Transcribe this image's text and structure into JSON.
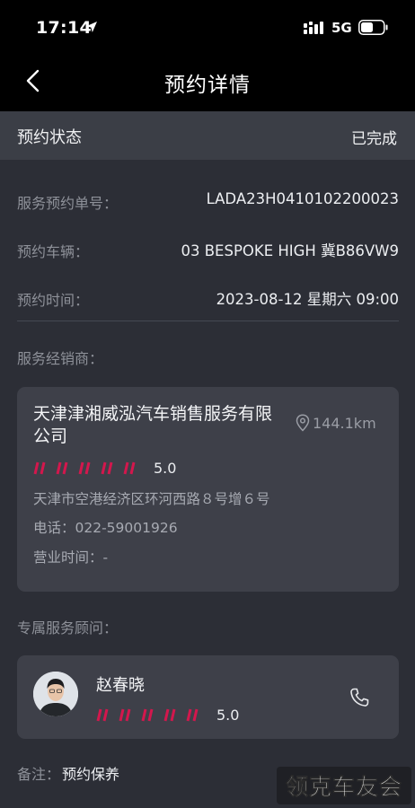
{
  "statusbar": {
    "time": "17:14",
    "network": "5G",
    "icons": [
      "location-arrow-icon",
      "signal-icon",
      "battery-icon"
    ]
  },
  "navbar": {
    "title": "预约详情",
    "back_icon": "chevron-left-icon"
  },
  "status": {
    "label": "预约状态",
    "value": "已完成"
  },
  "details": [
    {
      "label": "服务预约单号：",
      "value": "LADA23H0410102200023"
    },
    {
      "label": "预约车辆：",
      "value": "03 BESPOKE HIGH 冀B86VW9"
    },
    {
      "label": "预约时间：",
      "value": "2023-08-12 星期六 09:00"
    }
  ],
  "dealer": {
    "section_label": "服务经销商：",
    "name": "天津津湘威泓汽车销售服务有限公司",
    "distance": "144.1km",
    "rating": "5.0",
    "rating_marks": 5,
    "address": "天津市空港经济区环河西路８号增６号",
    "phone": "电话：022-59001926",
    "hours": "营业时间：-"
  },
  "advisor": {
    "section_label": "专属服务顾问：",
    "name": "赵春晓",
    "rating": "5.0",
    "rating_marks": 5
  },
  "remark": {
    "label": "备注：",
    "value": "预约保养"
  },
  "watermark": "领克车友会",
  "colors": {
    "background": "#2c2e36",
    "card": "#3e4049",
    "accent": "#d3174d",
    "header": "#000000"
  }
}
